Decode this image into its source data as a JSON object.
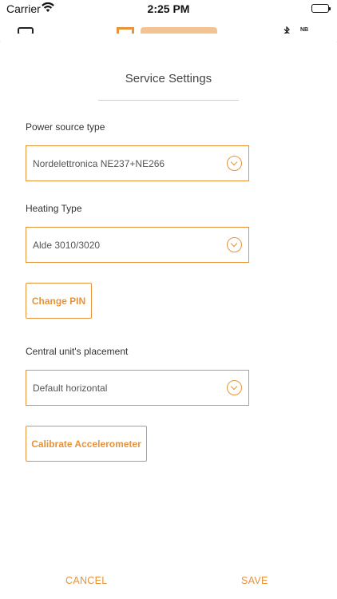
{
  "status_bar": {
    "carrier": "Carrier",
    "time": "2:25 PM"
  },
  "background_header": {
    "network_badge": "NB"
  },
  "dialog": {
    "title": "Service Settings",
    "power_source": {
      "label": "Power source type",
      "value": "Nordelettronica NE237+NE266"
    },
    "heating": {
      "label": "Heating Type",
      "value": "Alde 3010/3020"
    },
    "change_pin_label": "Change PIN",
    "placement": {
      "label": "Central unit's placement",
      "value": "Default horizontal"
    },
    "calibrate_label": "Calibrate Accelerometer",
    "cancel_label": "CANCEL",
    "save_label": "SAVE"
  },
  "colors": {
    "accent": "#e8923a",
    "text": "#333333",
    "overlay": "#8c8c8c"
  },
  "icons": [
    "wifi-icon",
    "battery-icon",
    "chevron-down-icon",
    "bluetooth-icon"
  ]
}
